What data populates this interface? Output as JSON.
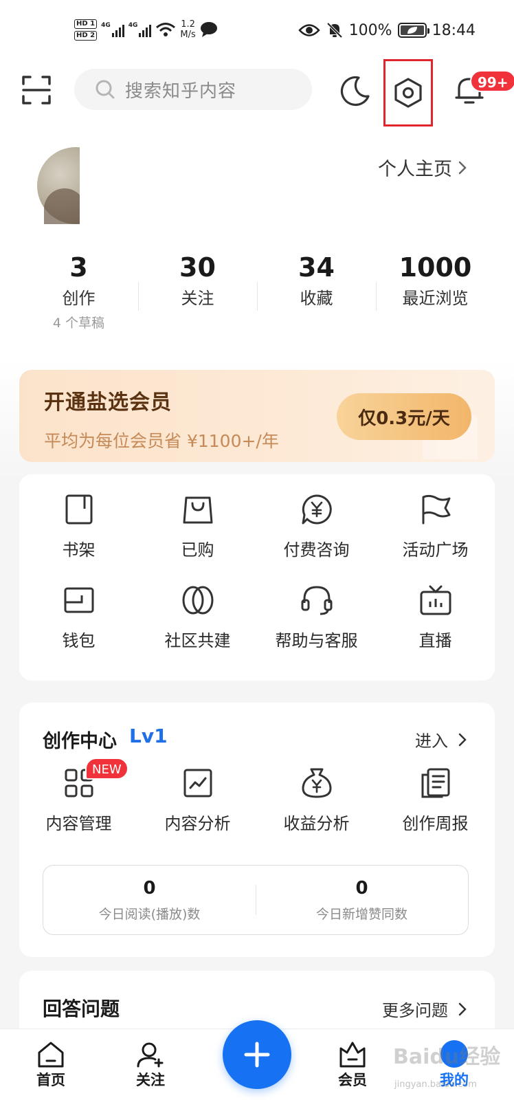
{
  "status_bar": {
    "hd1": "HD 1",
    "hd2": "HD 2",
    "signal1_label": "4G",
    "signal2_label": "4G",
    "speed_value": "1.2",
    "speed_unit": "M/s",
    "battery": "100%",
    "time": "18:44",
    "battery_level": 1.0
  },
  "top_bar": {
    "search_placeholder": "搜索知乎内容",
    "notification_badge": "99+"
  },
  "profile": {
    "home_link": "个人主页"
  },
  "stats": [
    {
      "value": "3",
      "label": "创作",
      "sub": "4 个草稿"
    },
    {
      "value": "30",
      "label": "关注",
      "sub": ""
    },
    {
      "value": "34",
      "label": "收藏",
      "sub": ""
    },
    {
      "value": "1000",
      "label": "最近浏览",
      "sub": ""
    }
  ],
  "vip": {
    "title": "开通盐选会员",
    "subtitle": "平均为每位会员省 ¥1100+/年",
    "button": "仅0.3元/天"
  },
  "tools": [
    {
      "label": "书架",
      "icon": "bookshelf-icon"
    },
    {
      "label": "已购",
      "icon": "shopping-bag-icon"
    },
    {
      "label": "付费咨询",
      "icon": "paid-consult-icon"
    },
    {
      "label": "活动广场",
      "icon": "flag-icon"
    },
    {
      "label": "钱包",
      "icon": "wallet-icon"
    },
    {
      "label": "社区共建",
      "icon": "leaf-icon"
    },
    {
      "label": "帮助与客服",
      "icon": "headset-icon"
    },
    {
      "label": "直播",
      "icon": "tv-icon"
    }
  ],
  "creation": {
    "title": "创作中心",
    "level": "Lv1",
    "enter": "进入",
    "new_badge": "NEW",
    "items": [
      {
        "label": "内容管理",
        "icon": "grid-icon"
      },
      {
        "label": "内容分析",
        "icon": "chart-icon"
      },
      {
        "label": "收益分析",
        "icon": "money-bag-icon"
      },
      {
        "label": "创作周报",
        "icon": "report-icon"
      }
    ],
    "today": [
      {
        "value": "0",
        "label": "今日阅读(播放)数"
      },
      {
        "value": "0",
        "label": "今日新增赞同数"
      }
    ]
  },
  "answer": {
    "title": "回答问题",
    "more": "更多问题"
  },
  "bottom_nav": {
    "home": "首页",
    "follow": "关注",
    "vip": "会员",
    "mine": "我的"
  },
  "watermark": {
    "text": "Baidu经验",
    "sub": "jingyan.baidu.com"
  },
  "colors": {
    "accent": "#1672f3",
    "badge": "#f0333b",
    "highlight_box": "#e0262c",
    "level": "#1f6fe6"
  }
}
